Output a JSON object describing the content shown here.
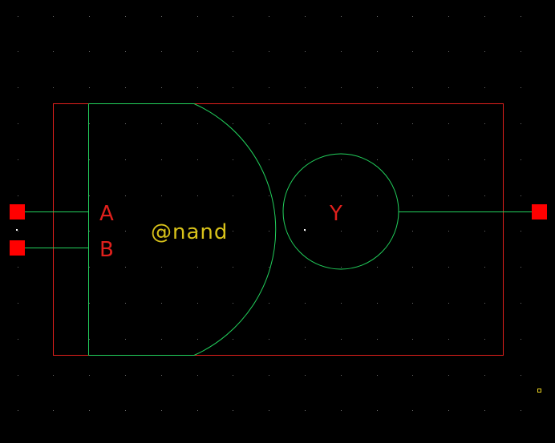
{
  "symbol": {
    "instance_label": "@nand",
    "pins": {
      "input_a": "A",
      "input_b": "B",
      "output_y": "Y"
    }
  },
  "colors": {
    "background": "#000000",
    "grid_dot": "#6e6e6e",
    "bounding_box": "#e0201c",
    "body_outline": "#22d05c",
    "pin_square": "#ff0000",
    "pin_label": "#e0201c",
    "instance_label": "#d8c21a",
    "origin_marker": "#ffffff",
    "anchor_marker": "#e8d020"
  }
}
